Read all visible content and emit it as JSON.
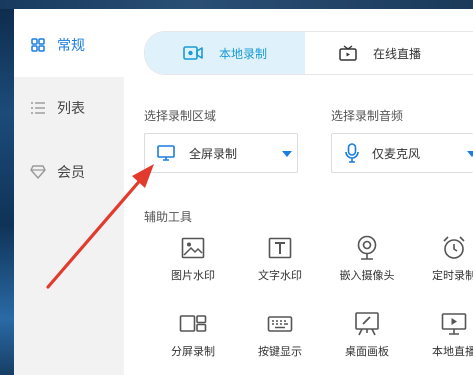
{
  "sidebar": {
    "items": [
      {
        "label": "常规",
        "icon": "grid-icon",
        "active": true
      },
      {
        "label": "列表",
        "icon": "list-icon",
        "active": false
      },
      {
        "label": "会员",
        "icon": "diamond-icon",
        "active": false
      }
    ]
  },
  "mode_switch": {
    "local": {
      "label": "本地录制",
      "icon": "camera-icon"
    },
    "online": {
      "label": "在线直播",
      "icon": "tv-icon"
    }
  },
  "record_area": {
    "label": "选择录制区域",
    "value": "全屏录制",
    "icon": "monitor-icon"
  },
  "record_audio": {
    "label": "选择录制音频",
    "value": "仅麦克风",
    "icon": "microphone-icon"
  },
  "tools": {
    "label": "辅助工具",
    "items": [
      {
        "label": "图片水印",
        "icon": "image-icon"
      },
      {
        "label": "文字水印",
        "icon": "text-icon"
      },
      {
        "label": "嵌入摄像头",
        "icon": "webcam-icon"
      },
      {
        "label": "定时录制",
        "icon": "alarm-clock-icon"
      },
      {
        "label": "分屏录制",
        "icon": "split-screen-icon"
      },
      {
        "label": "按键显示",
        "icon": "keyboard-icon"
      },
      {
        "label": "桌面画板",
        "icon": "whiteboard-icon"
      },
      {
        "label": "本地直播",
        "icon": "live-screen-icon"
      }
    ]
  },
  "colors": {
    "accent": "#1a7de0",
    "tab_active_bg": "#dff1fb",
    "tab_active_text": "#1a9ad6",
    "annotation_arrow": "#e23b2e"
  }
}
